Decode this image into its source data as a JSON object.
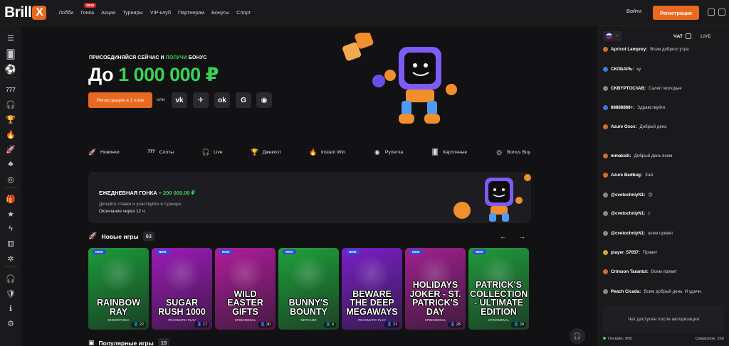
{
  "header": {
    "logo_text": "Brill",
    "logo_x": "X",
    "nav": [
      {
        "label": "Лобби"
      },
      {
        "label": "Гонка",
        "badge": "NEW"
      },
      {
        "label": "Акции"
      },
      {
        "label": "Турниры"
      },
      {
        "label": "VIP-клуб"
      },
      {
        "label": "Партнерам"
      },
      {
        "label": "Бонусы"
      },
      {
        "label": "Спорт"
      }
    ],
    "login": "Войти",
    "register": "Регистрация"
  },
  "hero": {
    "subtitle_1": "ПРИСОЕДИНЯЙСЯ СЕЙЧАС И ",
    "subtitle_2": "ПОЛУЧИ",
    "subtitle_3": " БОНУС",
    "title_1": "До ",
    "title_2": "1 000 000 ₽",
    "reg_button": "Регистрация в 1 клик",
    "or": "или",
    "social": [
      "vk",
      "tg",
      "ok",
      "G",
      "steam"
    ]
  },
  "categories": [
    "Новинки",
    "Слоты",
    "Live",
    "Джекпот",
    "Instant Win",
    "Рулетка",
    "Карточные",
    "Bonus Buy"
  ],
  "race": {
    "title_1": "ЕЖЕДНЕВНАЯ ГОНКА – ",
    "title_2": "200 000.00 ₽",
    "desc": "Делайте ставки и участвуйте в турнире.",
    "end": "Окончание через 12 ч."
  },
  "new_games": {
    "title": "Новые игры",
    "count": "93",
    "games": [
      {
        "title": "RAINBOW RAY",
        "provider": "ENDORPHINA",
        "players": "22",
        "new": "NEW",
        "color": "#1b9c3a"
      },
      {
        "title": "SUGAR RUSH 1000",
        "provider": "PRAGMATIC PLAY",
        "players": "17",
        "new": "NEW",
        "color": "#9c1bb8"
      },
      {
        "title": "WILD EASTER GIFTS",
        "provider": "SPINOMENAL",
        "players": "30",
        "new": "NEW",
        "color": "#b01c9c"
      },
      {
        "title": "BUNNY'S BOUNTY",
        "provider": "NETGAME",
        "players": "6",
        "new": "NEW",
        "color": "#1ea23b"
      },
      {
        "title": "BEWARE THE DEEP MEGAWAYS",
        "provider": "PRAGMATIC PLAY",
        "players": "21",
        "new": "NEW",
        "color": "#7a1fc8"
      },
      {
        "title": "HOLIDAYS JOKER - ST. PATRICK'S DAY",
        "provider": "SPINOMENAL",
        "players": "28",
        "new": "NEW",
        "color": "#a0208f"
      },
      {
        "title": "PATRICK'S COLLECTION - ULTIMATE EDITION",
        "provider": "SPINOMENAL",
        "players": "29",
        "new": "NEW",
        "color": "#1f9c3c"
      }
    ]
  },
  "popular_games": {
    "title": "Популярные игры",
    "count": "15"
  },
  "chat": {
    "tab_chat": "ЧАТ",
    "tab_live": "LIVE",
    "messages": [
      {
        "name": "Apricot Lamprey:",
        "text": "Всем доброго утра",
        "color": "#d46a2f"
      },
      {
        "name": "СКОБАРЬ:",
        "text": "ку",
        "color": "#3a7bd5"
      },
      {
        "name": "CKBYPTOC/\\AB:",
        "text": "Салют молодые",
        "color": "#888"
      },
      {
        "name": "88888888+:",
        "text": "Здравствуйте",
        "color": "#3a7bd5"
      },
      {
        "name": "Azure Oxox:",
        "text": "Добрый день",
        "color": "#d46a2f"
      },
      {
        "name": "mmaksik:",
        "text": "Добрый день всем",
        "color": "#d46a2f"
      },
      {
        "name": "Azure Bedbug:",
        "text": "Хай",
        "color": "#d46a2f"
      },
      {
        "name": "@cvetochniyN1:",
        "text": "😊",
        "color": "#888"
      },
      {
        "name": "@cvetochniyN1:",
        "text": "с",
        "color": "#888"
      },
      {
        "name": "@cvetochniyN1:",
        "text": "всем привет",
        "color": "#888"
      },
      {
        "name": "player_57057:",
        "text": "Привет",
        "color": "#d4a92f"
      },
      {
        "name": "Crimson Tarantul:",
        "text": "Всем привет",
        "color": "#d46a2f"
      },
      {
        "name": "Peach Cicada:",
        "text": "Всем добрый день. И удачи.",
        "color": "#888"
      }
    ],
    "auth_notice": "Чат доступен после авторизации",
    "online": "Онлайн: 906",
    "symbols": "Символов: 256"
  }
}
